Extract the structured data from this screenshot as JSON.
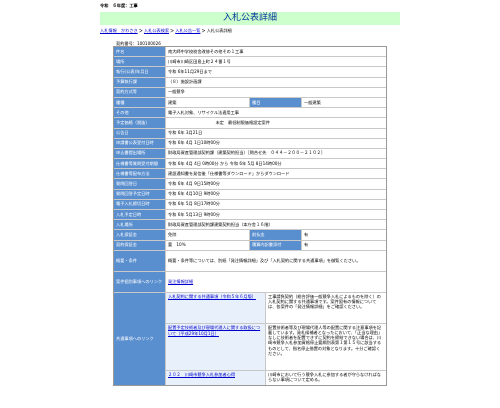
{
  "header": {
    "fiscal_year": "令和　６年度：工事",
    "title": "入札公表詳細"
  },
  "breadcrumb": {
    "items": [
      "入札情報　かわさき",
      "入札公表検索",
      "入札公告一覧"
    ],
    "current": "入札公表詳細"
  },
  "doc_number_label": "契約番号：100100026",
  "rows": {
    "kenmei": {
      "label": "件名",
      "value": "南大師中学校校舎改修その他その１工事"
    },
    "place": {
      "label": "場所",
      "value": "川崎市川崎区田島上町２４番１号"
    },
    "announce_date": {
      "label": "執行(公表)年月日",
      "value": "令和 6年11月29日まで"
    },
    "budget": {
      "label": "予算執行課",
      "value": "（８）施設計画課"
    },
    "method": {
      "label": "契約方式等",
      "value": "一般競争"
    },
    "type": {
      "label": "種種",
      "value": "建築",
      "label2": "種目",
      "value2": "一般建築"
    },
    "other": {
      "label": "その他",
      "value": "電子入札対象、リサイクル法適用工事"
    },
    "price": {
      "label": "予定価格（税抜）",
      "value": "未定",
      "value_note": "最低制限価格設定案件"
    },
    "notice_date": {
      "label": "公告日",
      "value": "令和 6年 3月21日"
    },
    "qual_date": {
      "label": "申請書公表受付日時",
      "value": "令和 6年 4月 1日10時00分"
    },
    "app_place": {
      "label": "申込書提出場所",
      "value": "財政局資産管理部契約課（建築契約担当）［問合せ先　０４４－２００－２１０２］"
    },
    "q_period": {
      "label": "仕様書等質問受付期間",
      "value": "令和 6年 4月 4日 0時00分 から 令和 6年 5月 8日14時00分"
    },
    "spec_method": {
      "label": "仕様書等配布方法",
      "value": "建設通知書を発信後「仕様書等ダウンロード」からダウンロード"
    },
    "reply_date": {
      "label": "質問回答日",
      "value": "令和 6年 4月 9日15時00分"
    },
    "doc_due": {
      "label": "質問回答予定日時",
      "value": "令和 6年 4月10日 9時00分"
    },
    "bid_period": {
      "label": "電子入札締切日時",
      "value": "令和 6年 5月 8日17時00分"
    },
    "open_date": {
      "label": "入札予定日時",
      "value": "令和 6年 5月13日 9時00分"
    },
    "open_place": {
      "label": "入札場所",
      "value": "財政局資産管理部契約課建築契約担当（本庁舎１６階）"
    },
    "bid_deposit": {
      "label": "入札保証金",
      "value": "免除",
      "label2": "前払金",
      "value2": "有"
    },
    "contract_deposit": {
      "label": "契約保証金",
      "value": "要　10%",
      "label2": "積算内訳書添付",
      "value2": "有"
    },
    "notes": {
      "label": "概要・条件",
      "value": "概要・条件等については、別紙「発注情報詳細」及び「入札契約に関する共通事項」を御覧ください。"
    },
    "detail_link": {
      "label": "案件個別事項へのリンク",
      "value": "発注情報詳細"
    },
    "common": {
      "label": "共通事項へのリンク",
      "items": [
        {
          "link": "入札契約に関する共通事項（令和５年６月版）",
          "desc": "工事請負契約（総合評価一般競争入札によるものを除く）の入札契約に関する共通事項です。案件固有の情報については、各案件の「発注情報詳細」をご確認ください。"
        },
        {
          "link": "配置予定技術者及び現場代理人に関する取扱について（平成29年10月1日）",
          "desc": "配置技術者等及び現場代理人等の配置に関する注意事項を記載しています。発札候補者となったにおいて、「正当な理由」なしに技術者を配置できずに契約を締結できない場合は、川崎市競争入札参加資格停止要綱別表第１第１５号に該当するものとして、指名停止措置の対象となります。十分ご確認ください。"
        },
        {
          "link": "２０２　川崎市競争入札参加者心得",
          "desc": "川崎市において行う競争入札に参加する者が守らなければならない事項について定める。"
        }
      ]
    }
  }
}
